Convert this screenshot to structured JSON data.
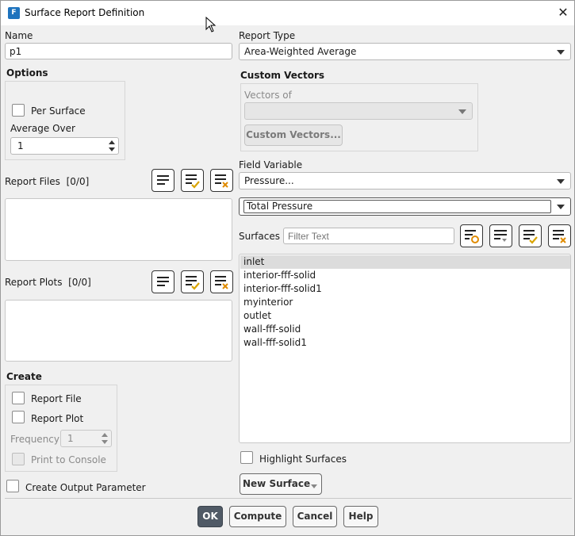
{
  "window": {
    "title": "Surface Report Definition",
    "app_badge": "F"
  },
  "name": {
    "label": "Name",
    "value": "p1"
  },
  "options": {
    "title": "Options",
    "per_surface_label": "Per Surface",
    "average_over_label": "Average Over",
    "average_over_value": "1"
  },
  "report_files": {
    "label": "Report Files",
    "count": "[0/0]"
  },
  "report_plots": {
    "label": "Report Plots",
    "count": "[0/0]"
  },
  "create": {
    "title": "Create",
    "report_file_label": "Report File",
    "report_plot_label": "Report Plot",
    "frequency_label": "Frequency",
    "frequency_value": "1",
    "print_to_console_label": "Print to Console",
    "create_output_parameter_label": "Create Output Parameter"
  },
  "report_type": {
    "label": "Report Type",
    "value": "Area-Weighted Average"
  },
  "custom_vectors": {
    "title": "Custom Vectors",
    "vectors_of_label": "Vectors of",
    "vectors_of_value": "",
    "button_label": "Custom Vectors..."
  },
  "field_variable": {
    "label": "Field Variable",
    "category": "Pressure...",
    "variable": "Total Pressure"
  },
  "surfaces": {
    "label": "Surfaces",
    "filter_placeholder": "Filter Text",
    "items": [
      "inlet",
      "interior-fff-solid",
      "interior-fff-solid1",
      "myinterior",
      "outlet",
      "wall-fff-solid",
      "wall-fff-solid1"
    ],
    "selected_index": 0
  },
  "highlight_surfaces_label": "Highlight Surfaces",
  "new_surface_label": "New Surface",
  "buttons": {
    "ok": "OK",
    "compute": "Compute",
    "cancel": "Cancel",
    "help": "Help"
  },
  "colors": {
    "accent": "#1e73be",
    "primary_button": "#505a66",
    "check_yellow": "#d9a400",
    "clear_orange": "#e08b00"
  }
}
